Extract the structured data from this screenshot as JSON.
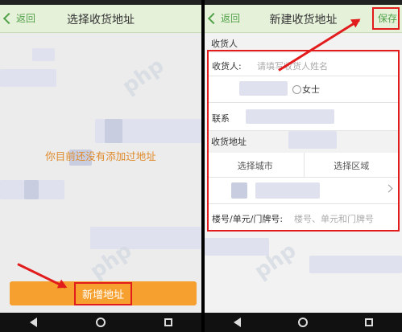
{
  "left": {
    "back_label": "返回",
    "title": "选择收货地址",
    "empty_message": "你目前还没有添加过地址",
    "add_button_label": "新增地址"
  },
  "right": {
    "back_label": "返回",
    "title": "新建收货地址",
    "save_label": "保存",
    "section_consignee": "收货人",
    "consignee_label": "收货人:",
    "consignee_placeholder": "请填写收货人姓名",
    "gender_female": "女士",
    "contact_label": "联系",
    "section_address": "收货地址",
    "select_city": "选择城市",
    "select_area": "选择区域",
    "building_label": "楼号/单元/门牌号:",
    "building_placeholder": "楼号、单元和门牌号"
  },
  "accent_color": "#52a24a",
  "highlight_color": "#e21c1c",
  "button_color": "#f6a12f"
}
